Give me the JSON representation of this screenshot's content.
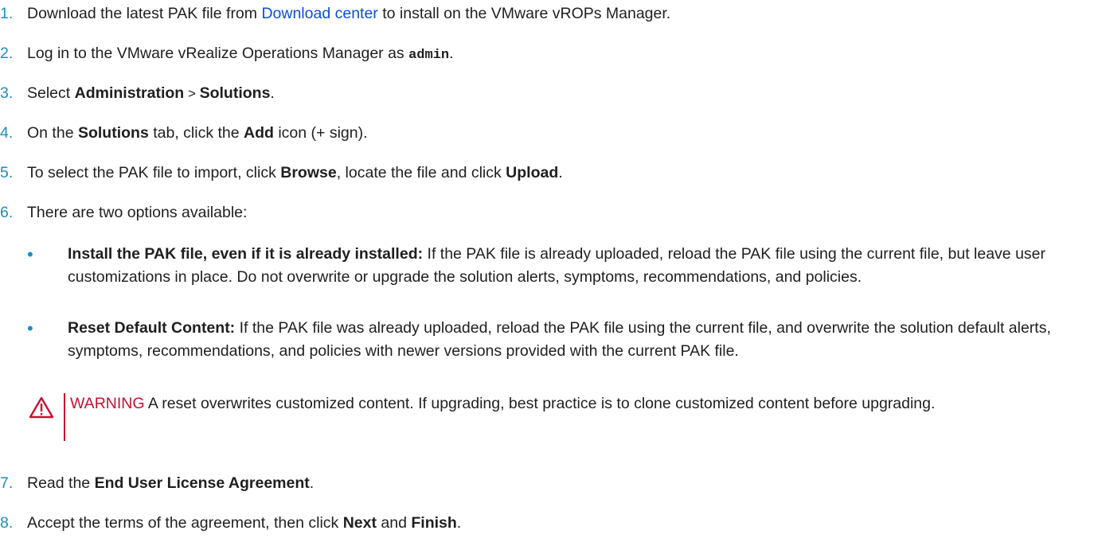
{
  "steps": [
    {
      "num": "1.",
      "before": "Download the latest PAK file from ",
      "link": "Download center",
      "after": " to install on the VMware vROPs Manager."
    },
    {
      "num": "2.",
      "before": "Log in to the VMware vRealize Operations Manager as ",
      "code": "admin",
      "after": "."
    },
    {
      "num": "3.",
      "before": "Select ",
      "bold1": "Administration",
      "sep": " > ",
      "bold2": "Solutions",
      "after": "."
    },
    {
      "num": "4.",
      "before": "On the ",
      "bold1": "Solutions",
      "mid": " tab, click the ",
      "bold2": "Add",
      "after": " icon (+ sign)."
    },
    {
      "num": "5.",
      "before": "To select the PAK file to import, click ",
      "bold1": "Browse",
      "mid": ", locate the file and click ",
      "bold2": "Upload",
      "after": "."
    },
    {
      "num": "6.",
      "text": "There are two options available:"
    },
    {
      "num": "7.",
      "before": "Read the ",
      "bold1": "End User License Agreement",
      "after": "."
    },
    {
      "num": "8.",
      "before": "Accept the terms of the agreement, then click ",
      "bold1": "Next",
      "mid": " and ",
      "bold2": "Finish",
      "after": "."
    }
  ],
  "options": [
    {
      "bullet": "•",
      "title": "Install the PAK file, even if it is already installed:",
      "text": " If the PAK file is already uploaded, reload the PAK file using the current file, but leave user customizations in place. Do not overwrite or upgrade the solution alerts, symptoms, recommendations, and policies."
    },
    {
      "bullet": "•",
      "title": "Reset Default Content:",
      "text": " If the PAK file was already uploaded, reload the PAK file using the current file, and overwrite the solution default alerts, symptoms, recommendations, and policies with newer versions provided with the current PAK file."
    }
  ],
  "warning": {
    "icon": "warning-triangle-icon",
    "label": "WARNING",
    "text": " A reset overwrites customized content. If upgrading, best practice is to clone customized content before upgrading."
  },
  "colors": {
    "step_number": "#1a8fbf",
    "link": "#0a4fd6",
    "warning": "#c8102e",
    "text": "#1f1f1f"
  }
}
